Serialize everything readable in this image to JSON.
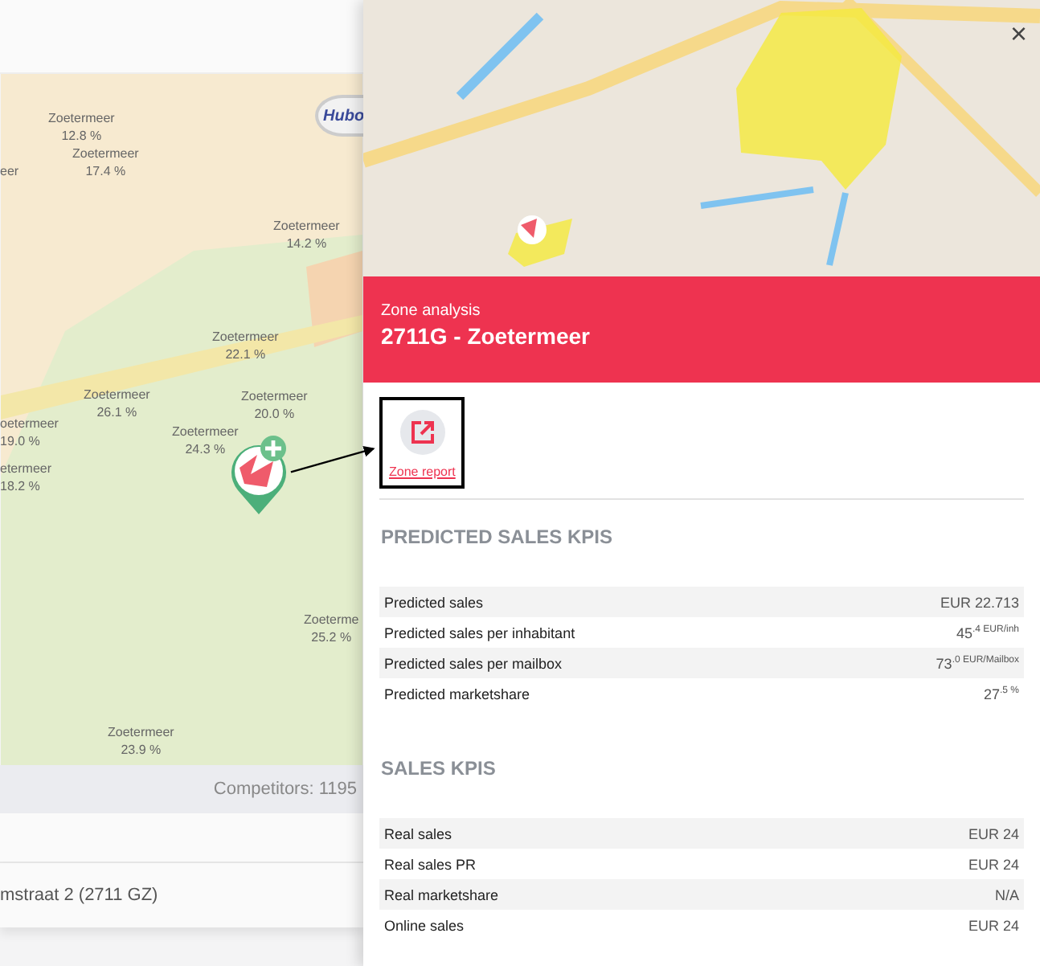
{
  "left_map": {
    "zone_labels": [
      {
        "name": "Zoetermeer",
        "value": "12.8 %"
      },
      {
        "name": "eer"
      },
      {
        "name": "Zoetermeer",
        "value": "17.4 %"
      },
      {
        "name": "Zoetermeer",
        "value": "14.2 %"
      },
      {
        "name": "Zoetermeer",
        "value": "22.1 %"
      },
      {
        "name": "Zoetermeer",
        "value": "26.1 %"
      },
      {
        "name": "Zoetermeer",
        "value": "20.0 %"
      },
      {
        "name": "oetermeer",
        "value": "19.0 %"
      },
      {
        "name": "Zoetermeer",
        "value": "24.3 %"
      },
      {
        "name": "etermeer",
        "value": "18.2 %"
      },
      {
        "name": "Zoeterme",
        "value": "25.2 %"
      },
      {
        "name": "Zoetermeer",
        "value": "23.9 %"
      }
    ],
    "competitor_pin": {
      "label": "Hubo"
    }
  },
  "competitors": "Competitors: 1195",
  "address": "mstraat 2 (2711 GZ)",
  "panel": {
    "close": "×",
    "subtitle": "Zone analysis",
    "title": "2711G - Zoetermeer",
    "actions": [
      {
        "label": "Zone report",
        "highlighted": true
      }
    ],
    "sections": [
      {
        "heading": "PREDICTED SALES KPIS",
        "rows": [
          {
            "label": "Predicted sales",
            "value": "EUR 22.713"
          },
          {
            "label": "Predicted sales per inhabitant",
            "value": "45$^{.4 EUR/inh}$"
          },
          {
            "label": "Predicted sales per mailbox",
            "value": "73$^{.0 EUR/Mailbox}$"
          },
          {
            "label": "Predicted marketshare",
            "value": "27$^{.5 %}$"
          }
        ]
      },
      {
        "heading": "SALES KPIS",
        "rows": [
          {
            "label": "Real sales",
            "value": "EUR 24"
          },
          {
            "label": "Real sales PR",
            "value": "EUR 24"
          },
          {
            "label": "Real marketshare",
            "value": "N/A"
          },
          {
            "label": "Online sales",
            "value": "EUR 24"
          }
        ]
      }
    ]
  }
}
